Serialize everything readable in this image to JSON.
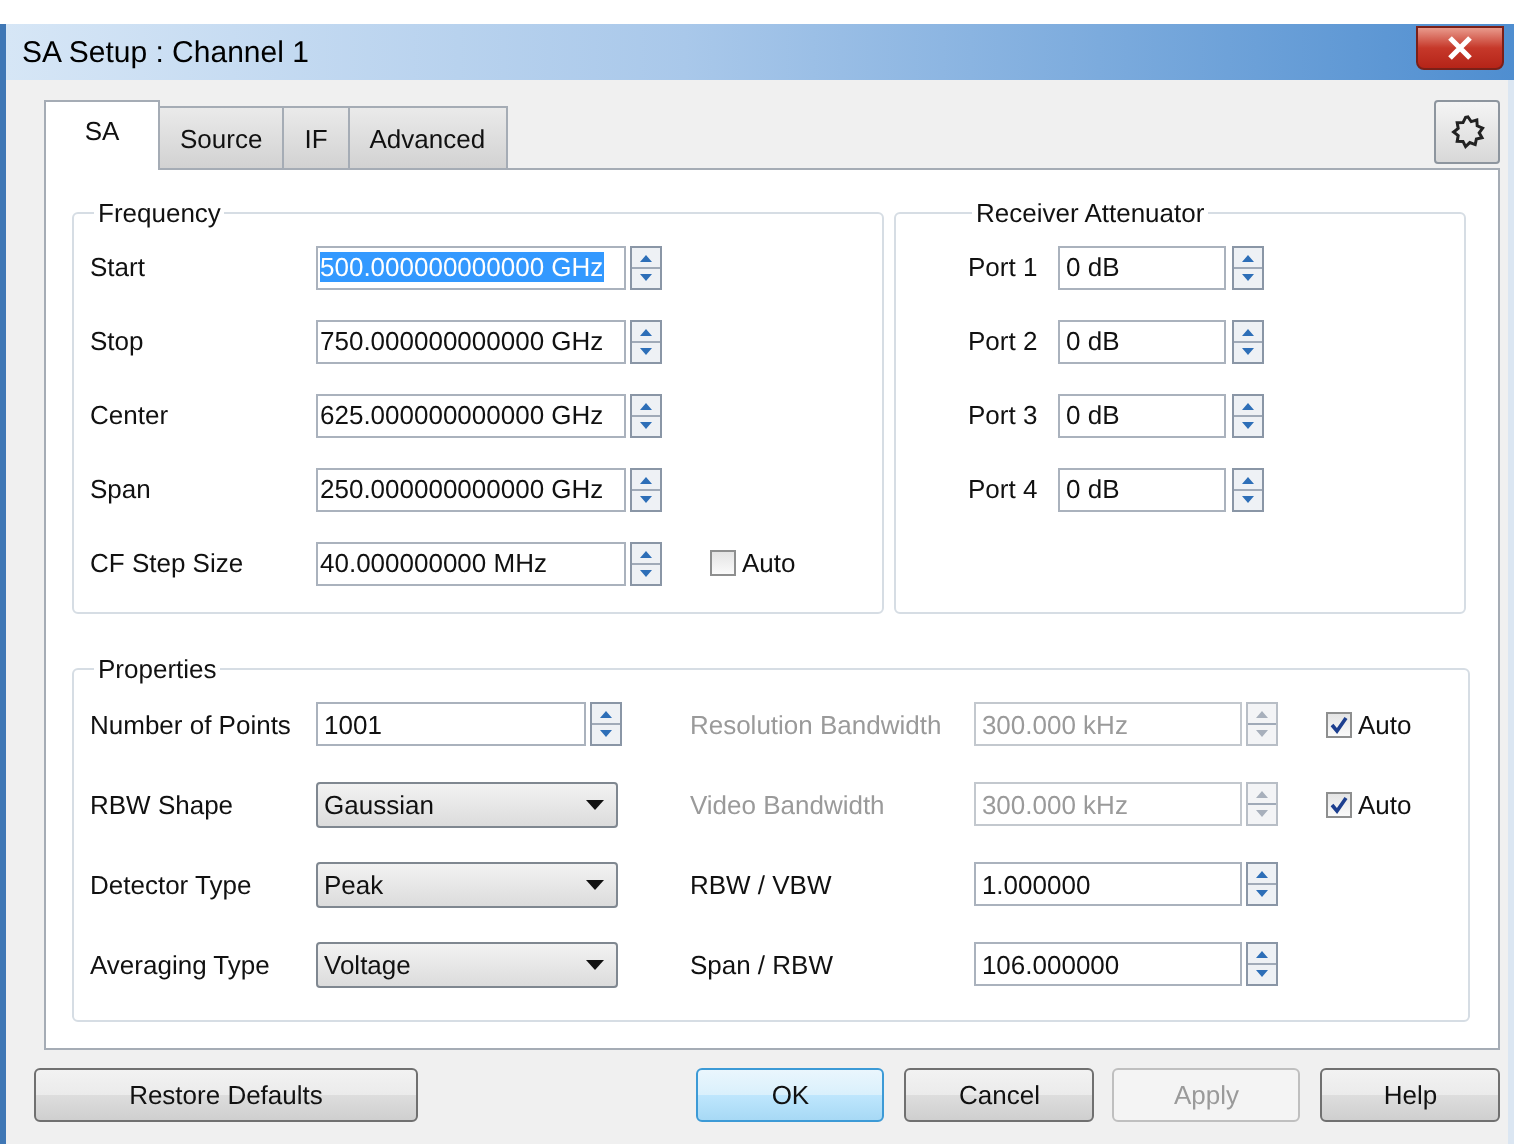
{
  "window": {
    "title": "SA Setup : Channel 1"
  },
  "tabs": [
    {
      "label": "SA",
      "selected": true
    },
    {
      "label": "Source",
      "selected": false
    },
    {
      "label": "IF",
      "selected": false
    },
    {
      "label": "Advanced",
      "selected": false
    }
  ],
  "frequency": {
    "title": "Frequency",
    "fields": [
      {
        "label": "Start",
        "value": "500.000000000000 GHz",
        "selected": true
      },
      {
        "label": "Stop",
        "value": "750.000000000000 GHz",
        "selected": false
      },
      {
        "label": "Center",
        "value": "625.000000000000 GHz",
        "selected": false
      },
      {
        "label": "Span",
        "value": "250.000000000000 GHz",
        "selected": false
      },
      {
        "label": "CF Step Size",
        "value": "40.000000000 MHz",
        "selected": false,
        "auto": {
          "label": "Auto",
          "checked": false
        }
      }
    ]
  },
  "attenuator": {
    "title": "Receiver Attenuator",
    "ports": [
      {
        "label": "Port 1",
        "value": "0 dB"
      },
      {
        "label": "Port 2",
        "value": "0 dB"
      },
      {
        "label": "Port 3",
        "value": "0 dB"
      },
      {
        "label": "Port 4",
        "value": "0 dB"
      }
    ]
  },
  "properties": {
    "title": "Properties",
    "left": [
      {
        "kind": "spin",
        "label": "Number of Points",
        "value": "1001"
      },
      {
        "kind": "dropdown",
        "label": "RBW Shape",
        "value": "Gaussian"
      },
      {
        "kind": "dropdown",
        "label": "Detector Type",
        "value": "Peak"
      },
      {
        "kind": "dropdown",
        "label": "Averaging Type",
        "value": "Voltage"
      }
    ],
    "right": [
      {
        "label": "Resolution Bandwidth",
        "value": "300.000 kHz",
        "disabled": true,
        "auto": {
          "label": "Auto",
          "checked": true
        }
      },
      {
        "label": "Video Bandwidth",
        "value": "300.000 kHz",
        "disabled": true,
        "auto": {
          "label": "Auto",
          "checked": true
        }
      },
      {
        "label": "RBW / VBW",
        "value": "1.000000",
        "disabled": false
      },
      {
        "label": "Span / RBW",
        "value": "106.000000",
        "disabled": false
      }
    ]
  },
  "buttons": [
    {
      "label": "Restore Defaults",
      "default": false,
      "disabled": false
    },
    {
      "label": "OK",
      "default": true,
      "disabled": false
    },
    {
      "label": "Cancel",
      "default": false,
      "disabled": false
    },
    {
      "label": "Apply",
      "default": false,
      "disabled": true
    },
    {
      "label": "Help",
      "default": false,
      "disabled": false
    }
  ]
}
